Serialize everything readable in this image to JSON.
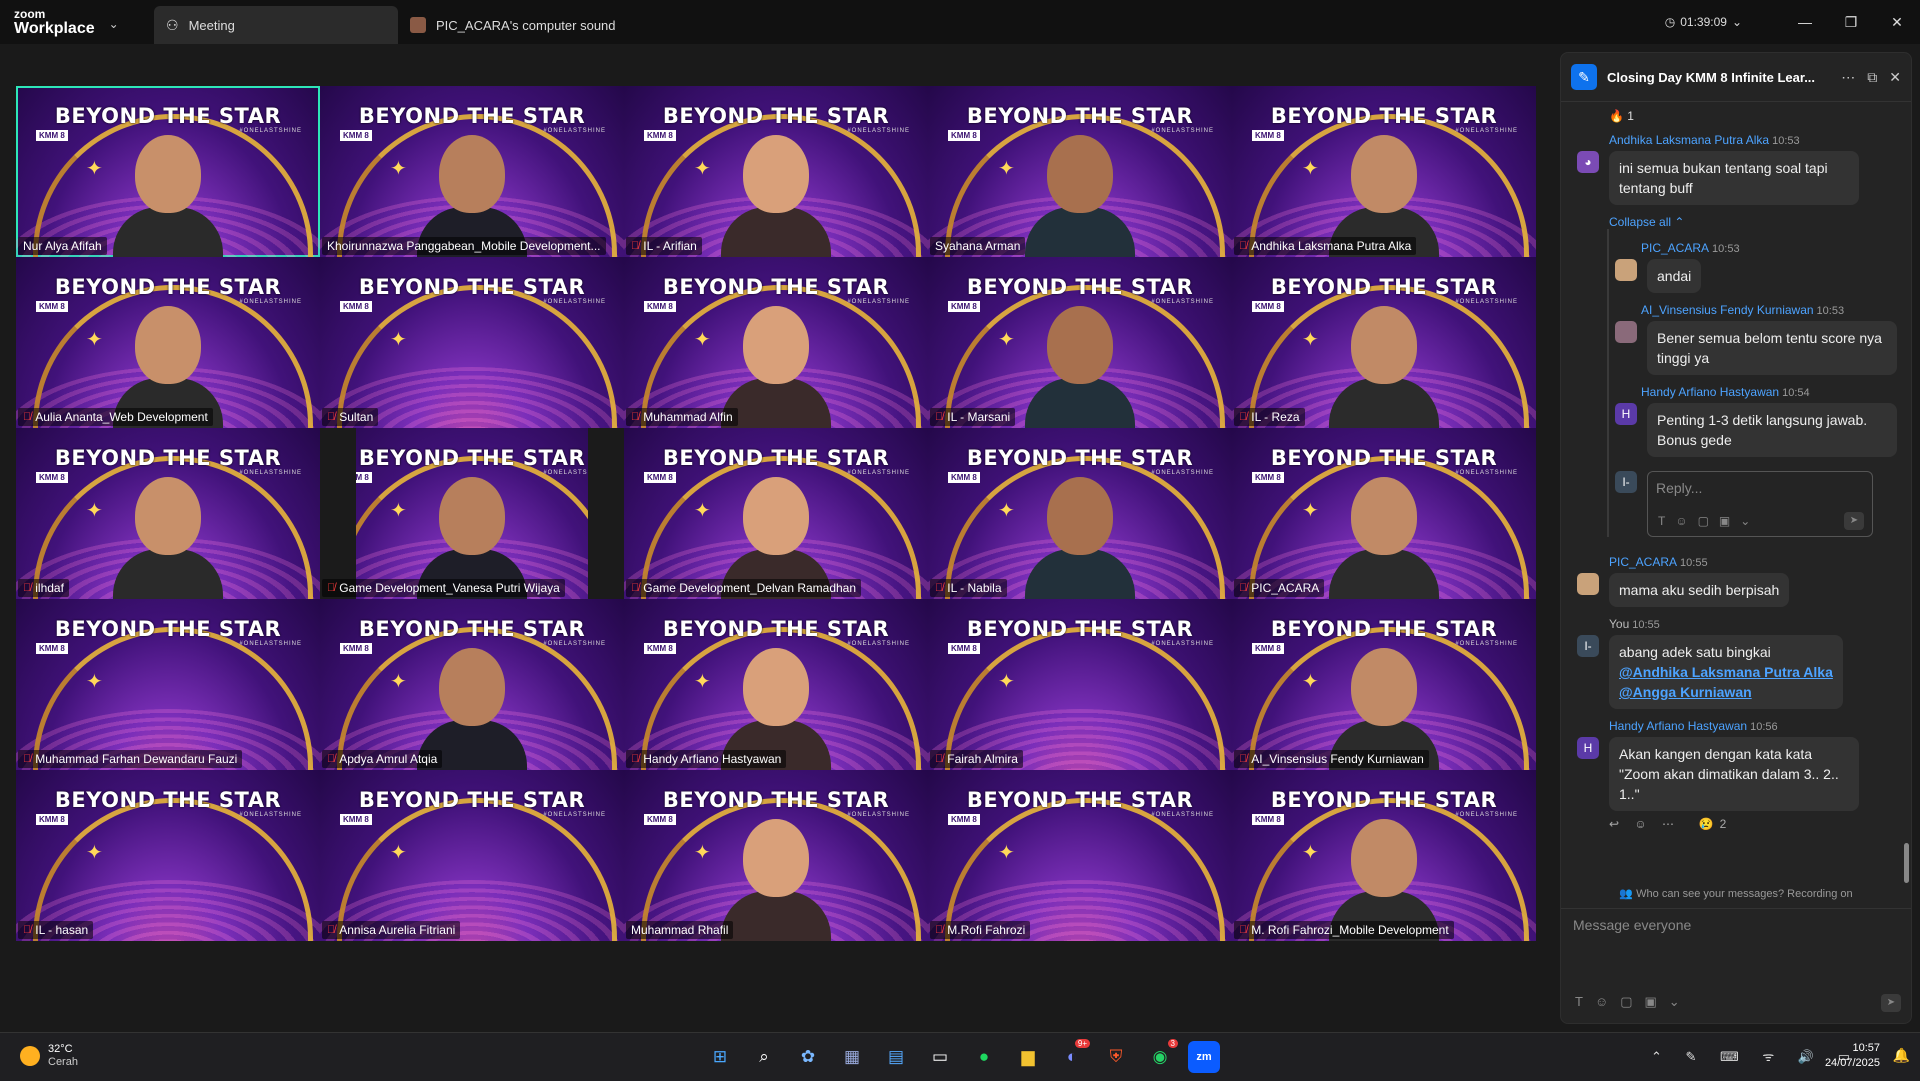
{
  "titlebar": {
    "brand_top": "zoom",
    "brand_bottom": "Workplace",
    "tabs": [
      {
        "label": "Meeting",
        "icon": "meeting-icon"
      },
      {
        "label": "PIC_ACARA's computer sound",
        "icon": "user-avatar"
      }
    ],
    "timer": "01:39:09"
  },
  "banner": {
    "logo_text": "BEYOND THE STAR",
    "badge": "KMM 8",
    "tagline": "#ONELASTSHINE"
  },
  "participants": [
    {
      "name": "Nur Alya Afifah",
      "muted": false,
      "active": true,
      "has_video": true
    },
    {
      "name": "Khoirunnazwa Panggabean_Mobile Development...",
      "muted": false,
      "has_video": true
    },
    {
      "name": "IL - Arifian",
      "muted": true,
      "has_video": true
    },
    {
      "name": "Syahana Arman",
      "muted": false,
      "has_video": true
    },
    {
      "name": "Andhika Laksmana Putra Alka",
      "muted": true,
      "has_video": true
    },
    {
      "name": "Aulia Ananta_Web Development",
      "muted": true,
      "has_video": true
    },
    {
      "name": "Sultan",
      "muted": true,
      "has_video": false
    },
    {
      "name": "Muhammad Alfin",
      "muted": true,
      "has_video": true
    },
    {
      "name": "IL - Marsani",
      "muted": true,
      "has_video": true
    },
    {
      "name": "IL - Reza",
      "muted": true,
      "has_video": true
    },
    {
      "name": "ilhdaf",
      "muted": true,
      "has_video": true
    },
    {
      "name": "Game Development_Vanesa Putri Wijaya",
      "muted": true,
      "has_video": true,
      "pillarbox": true
    },
    {
      "name": "Game Development_Delvan Ramadhan",
      "muted": true,
      "has_video": true
    },
    {
      "name": "IL - Nabila",
      "muted": true,
      "has_video": true
    },
    {
      "name": "PIC_ACARA",
      "muted": true,
      "has_video": true
    },
    {
      "name": "Muhammad Farhan Dewandaru Fauzi",
      "muted": true,
      "has_video": false
    },
    {
      "name": "Apdya Amrul Atqia",
      "muted": true,
      "has_video": true
    },
    {
      "name": "Handy Arfiano Hastyawan",
      "muted": true,
      "has_video": true
    },
    {
      "name": "Fairah Almira",
      "muted": true,
      "has_video": false
    },
    {
      "name": "AI_Vinsensius Fendy Kurniawan",
      "muted": true,
      "has_video": true
    },
    {
      "name": "IL - hasan",
      "muted": true,
      "has_video": false
    },
    {
      "name": "Annisa Aurelia Fitriani",
      "muted": true,
      "has_video": false
    },
    {
      "name": "Muhammad Rhafil",
      "muted": false,
      "has_video": true
    },
    {
      "name": "M.Rofi Fahrozi",
      "muted": true,
      "has_video": false
    },
    {
      "name": "M. Rofi Fahrozi_Mobile Development",
      "muted": true,
      "has_video": true
    }
  ],
  "chat": {
    "title": "Closing Day KMM 8 Infinite Lear...",
    "top_reaction": "1",
    "messages": [
      {
        "sender": "Andhika Laksmana Putra Alka",
        "time": "10:53",
        "text": "ini semua bukan tentang soal tapi tentang buff"
      }
    ],
    "collapse_label": "Collapse all",
    "thread": [
      {
        "sender": "PIC_ACARA",
        "time": "10:53",
        "text": "andai"
      },
      {
        "sender": "AI_Vinsensius Fendy Kurniawan",
        "time": "10:53",
        "text": "Bener semua belom tentu score nya tinggi ya"
      },
      {
        "sender": "Handy Arfiano Hastyawan",
        "time": "10:54",
        "text": "Penting 1-3 detik langsung jawab. Bonus gede",
        "avatar": "H"
      }
    ],
    "reply_placeholder": "Reply...",
    "after": [
      {
        "sender": "PIC_ACARA",
        "time": "10:55",
        "text": "mama aku sedih berpisah"
      },
      {
        "sender": "You",
        "time": "10:55",
        "text": "abang adek satu bingkai",
        "mentions": [
          "@Andhika Laksmana Putra Alka",
          "@Angga Kurniawan"
        ],
        "avatar": "I-"
      },
      {
        "sender": "Handy Arfiano Hastyawan",
        "time": "10:56",
        "text": "Akan kangen dengan kata kata \"Zoom akan dimatikan dalam 3.. 2.. 1..\"",
        "avatar": "H"
      }
    ],
    "last_reaction_count": "2",
    "privacy_note": "Who can see your messages? Recording on",
    "composer_placeholder": "Message everyone"
  },
  "taskbar": {
    "weather_temp": "32°C",
    "weather_desc": "Cerah",
    "time": "10:57",
    "date": "24/07/2025",
    "discord_badge": "9+",
    "whatsapp_badge": "3"
  }
}
